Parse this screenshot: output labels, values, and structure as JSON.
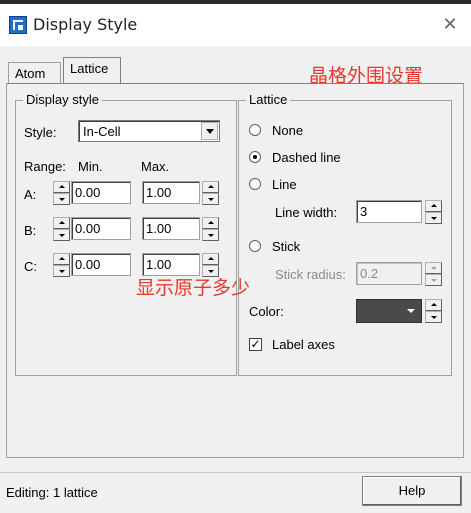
{
  "window": {
    "title": "Display Style"
  },
  "tabs": [
    {
      "label": "Atom"
    },
    {
      "label": "Lattice"
    }
  ],
  "annotations": {
    "top": "晶格外围设置",
    "middle": "显示原子多少"
  },
  "display_style": {
    "group_title": "Display style",
    "style_label": "Style:",
    "style_value": "In-Cell",
    "range_label": "Range:",
    "min_label": "Min.",
    "max_label": "Max.",
    "rows": [
      {
        "axis": "A:",
        "min": "0.00",
        "max": "1.00"
      },
      {
        "axis": "B:",
        "min": "0.00",
        "max": "1.00"
      },
      {
        "axis": "C:",
        "min": "0.00",
        "max": "1.00"
      }
    ]
  },
  "lattice": {
    "group_title": "Lattice",
    "options": [
      {
        "label": "None",
        "selected": false
      },
      {
        "label": "Dashed line",
        "selected": true
      },
      {
        "label": "Line",
        "selected": false
      },
      {
        "label": "Stick",
        "selected": false
      }
    ],
    "line_width_label": "Line width:",
    "line_width_value": "3",
    "stick_radius_label": "Stick radius:",
    "stick_radius_value": "0.2",
    "color_label": "Color:",
    "color_value": "#4a4a4a",
    "label_axes_label": "Label axes",
    "label_axes_checked": true
  },
  "status": {
    "text": "Editing: 1 lattice"
  },
  "help_button": {
    "label": "Help"
  }
}
